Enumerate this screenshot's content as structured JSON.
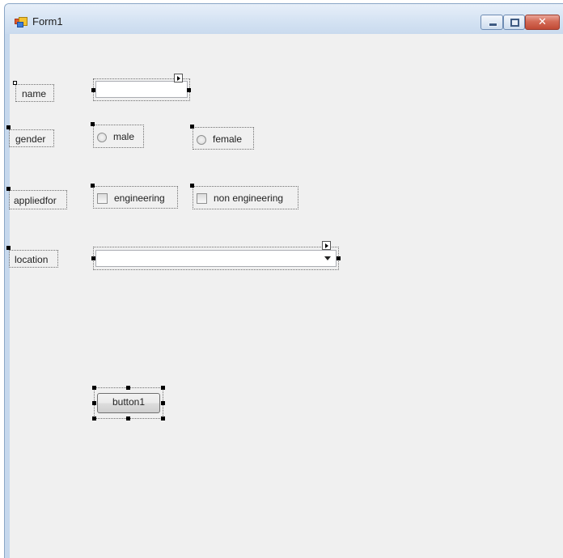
{
  "window": {
    "title": "Form1",
    "icon": "winforms-form-icon",
    "controls": {
      "minimize": "minimize-icon",
      "maximize": "maximize-icon",
      "close": "close-icon",
      "close_glyph": "✕"
    }
  },
  "form": {
    "name_label": "name",
    "name_value": "",
    "gender_label": "gender",
    "gender_options": [
      "male",
      "female"
    ],
    "appliedfor_label": "appliedfor",
    "appliedfor_options": [
      "engineering",
      "non engineering"
    ],
    "location_label": "location",
    "location_value": "",
    "button_label": "button1"
  },
  "colors": {
    "titlebar": "#d5e3f3",
    "client": "#f0f0f0",
    "close_button": "#c04a35"
  }
}
